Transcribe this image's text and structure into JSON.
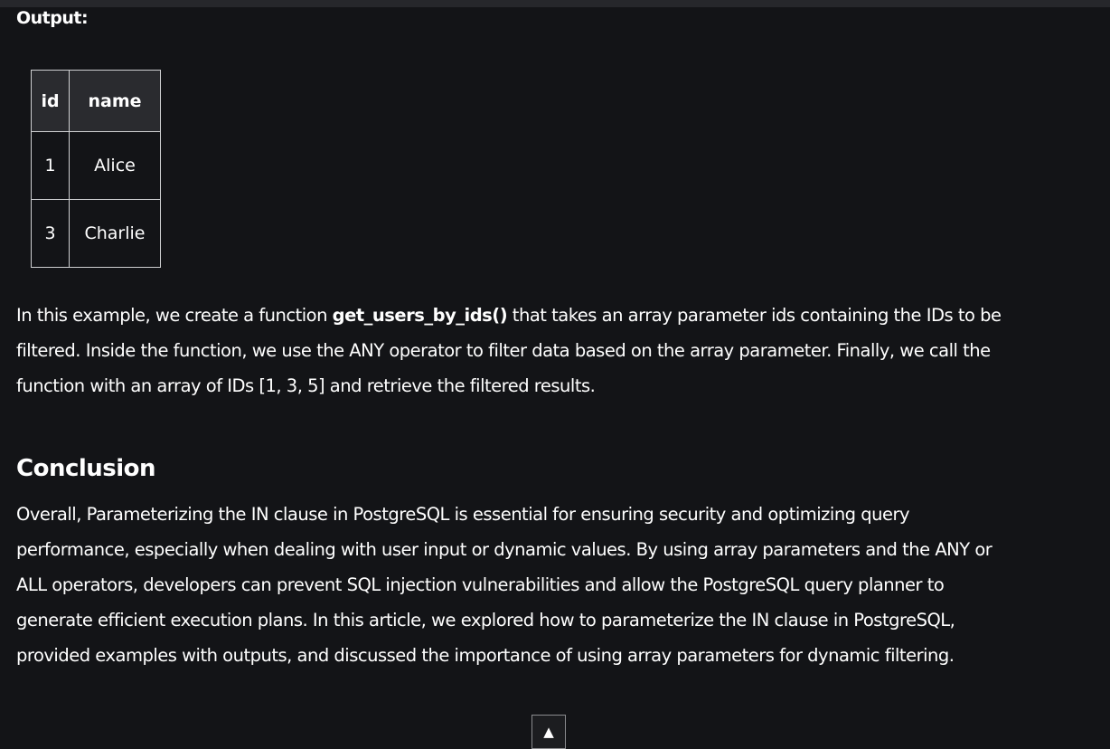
{
  "output_label": "Output:",
  "table": {
    "headers": [
      "id",
      "name"
    ],
    "rows": [
      [
        "1",
        "Alice"
      ],
      [
        "3",
        "Charlie"
      ]
    ]
  },
  "paragraph1": {
    "before": "In this example, we create a function ",
    "bold": "get_users_by_ids()",
    "after": " that takes an array parameter ids containing the IDs to be filtered. Inside the function, we use the ANY operator to filter data based on the array parameter. Finally, we call the function with an array of IDs [1, 3, 5] and retrieve the filtered results."
  },
  "conclusion_heading": "Conclusion",
  "conclusion_text": "Overall, Parameterizing the IN clause in PostgreSQL is essential for ensuring security and optimizing query performance, especially when dealing with user input or dynamic values. By using array parameters and the ANY or ALL operators, developers can prevent SQL injection vulnerabilities and allow the PostgreSQL query planner to generate efficient execution plans. In this article, we explored how to parameterize the IN clause in PostgreSQL, provided examples with outputs, and discussed the importance of using array parameters for dynamic filtering.",
  "scroll_top_icon": "triangle-up-icon",
  "scroll_top_glyph": "▲"
}
